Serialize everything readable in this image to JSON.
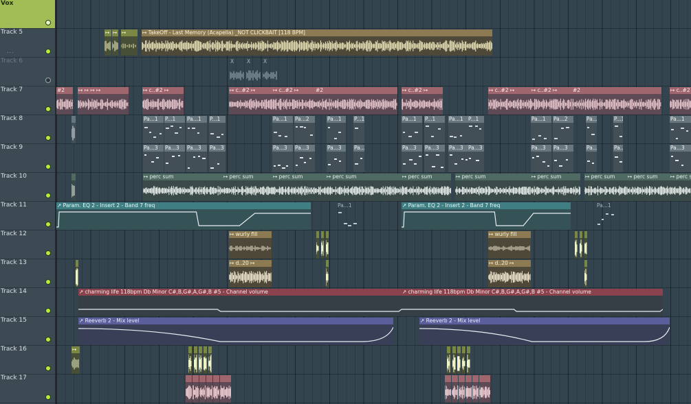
{
  "tracks": [
    {
      "name": "Vox",
      "selected": true,
      "dim": false,
      "led_on": true,
      "dots": "..."
    },
    {
      "name": "Track 5",
      "selected": false,
      "dim": false,
      "led_on": true,
      "dots": "..."
    },
    {
      "name": "Track 6",
      "selected": false,
      "dim": true,
      "led_on": false,
      "dots": ""
    },
    {
      "name": "Track 7",
      "selected": false,
      "dim": false,
      "led_on": true,
      "dots": ""
    },
    {
      "name": "Track 8",
      "selected": false,
      "dim": false,
      "led_on": true,
      "dots": ""
    },
    {
      "name": "Track 9",
      "selected": false,
      "dim": false,
      "led_on": true,
      "dots": ""
    },
    {
      "name": "Track 10",
      "selected": false,
      "dim": false,
      "led_on": true,
      "dots": ""
    },
    {
      "name": "Track 11",
      "selected": false,
      "dim": false,
      "led_on": true,
      "dots": ""
    },
    {
      "name": "Track 12",
      "selected": false,
      "dim": false,
      "led_on": true,
      "dots": ""
    },
    {
      "name": "Track 13",
      "selected": false,
      "dim": false,
      "led_on": true,
      "dots": ""
    },
    {
      "name": "Track 14",
      "selected": false,
      "dim": false,
      "led_on": true,
      "dots": ""
    },
    {
      "name": "Track 15",
      "selected": false,
      "dim": false,
      "led_on": true,
      "dots": ""
    },
    {
      "name": "Track 16",
      "selected": false,
      "dim": false,
      "led_on": true,
      "dots": ""
    },
    {
      "name": "Track 17",
      "selected": false,
      "dim": false,
      "led_on": true,
      "dots": ""
    }
  ],
  "clips": {
    "vox_main": "↦ TakeOff - Last Memory (Acapella) _NOT CLICKBAIT [118 BPM]",
    "vox_short": "↦",
    "t6_x": "X",
    "t7_c2": "↦ c..#2 ↦",
    "t7_2": "#2",
    "t7_ticks": "↦ ↦ ↦ ↦",
    "t8_pa1": "Pa...1",
    "t8_p1": "P...1",
    "t8_pa2": "Pa...2",
    "t9_pa3": "Pa...3",
    "perc": "↦ perc sum",
    "perc_partial": "erc sum",
    "eq_auto": "↗ Param. EQ 2 - Insert 2 - Band 7 freq",
    "pa1": "Pa...1",
    "wurly": "↦ wurly fill",
    "d20": "↦ d..20 ↦",
    "charming": "↗ charming life 118bpm Db Minor C#,B,G#,A,G#,B #5 - Channel volume",
    "reverb": "↗ Reeverb 2 - Mix level"
  }
}
